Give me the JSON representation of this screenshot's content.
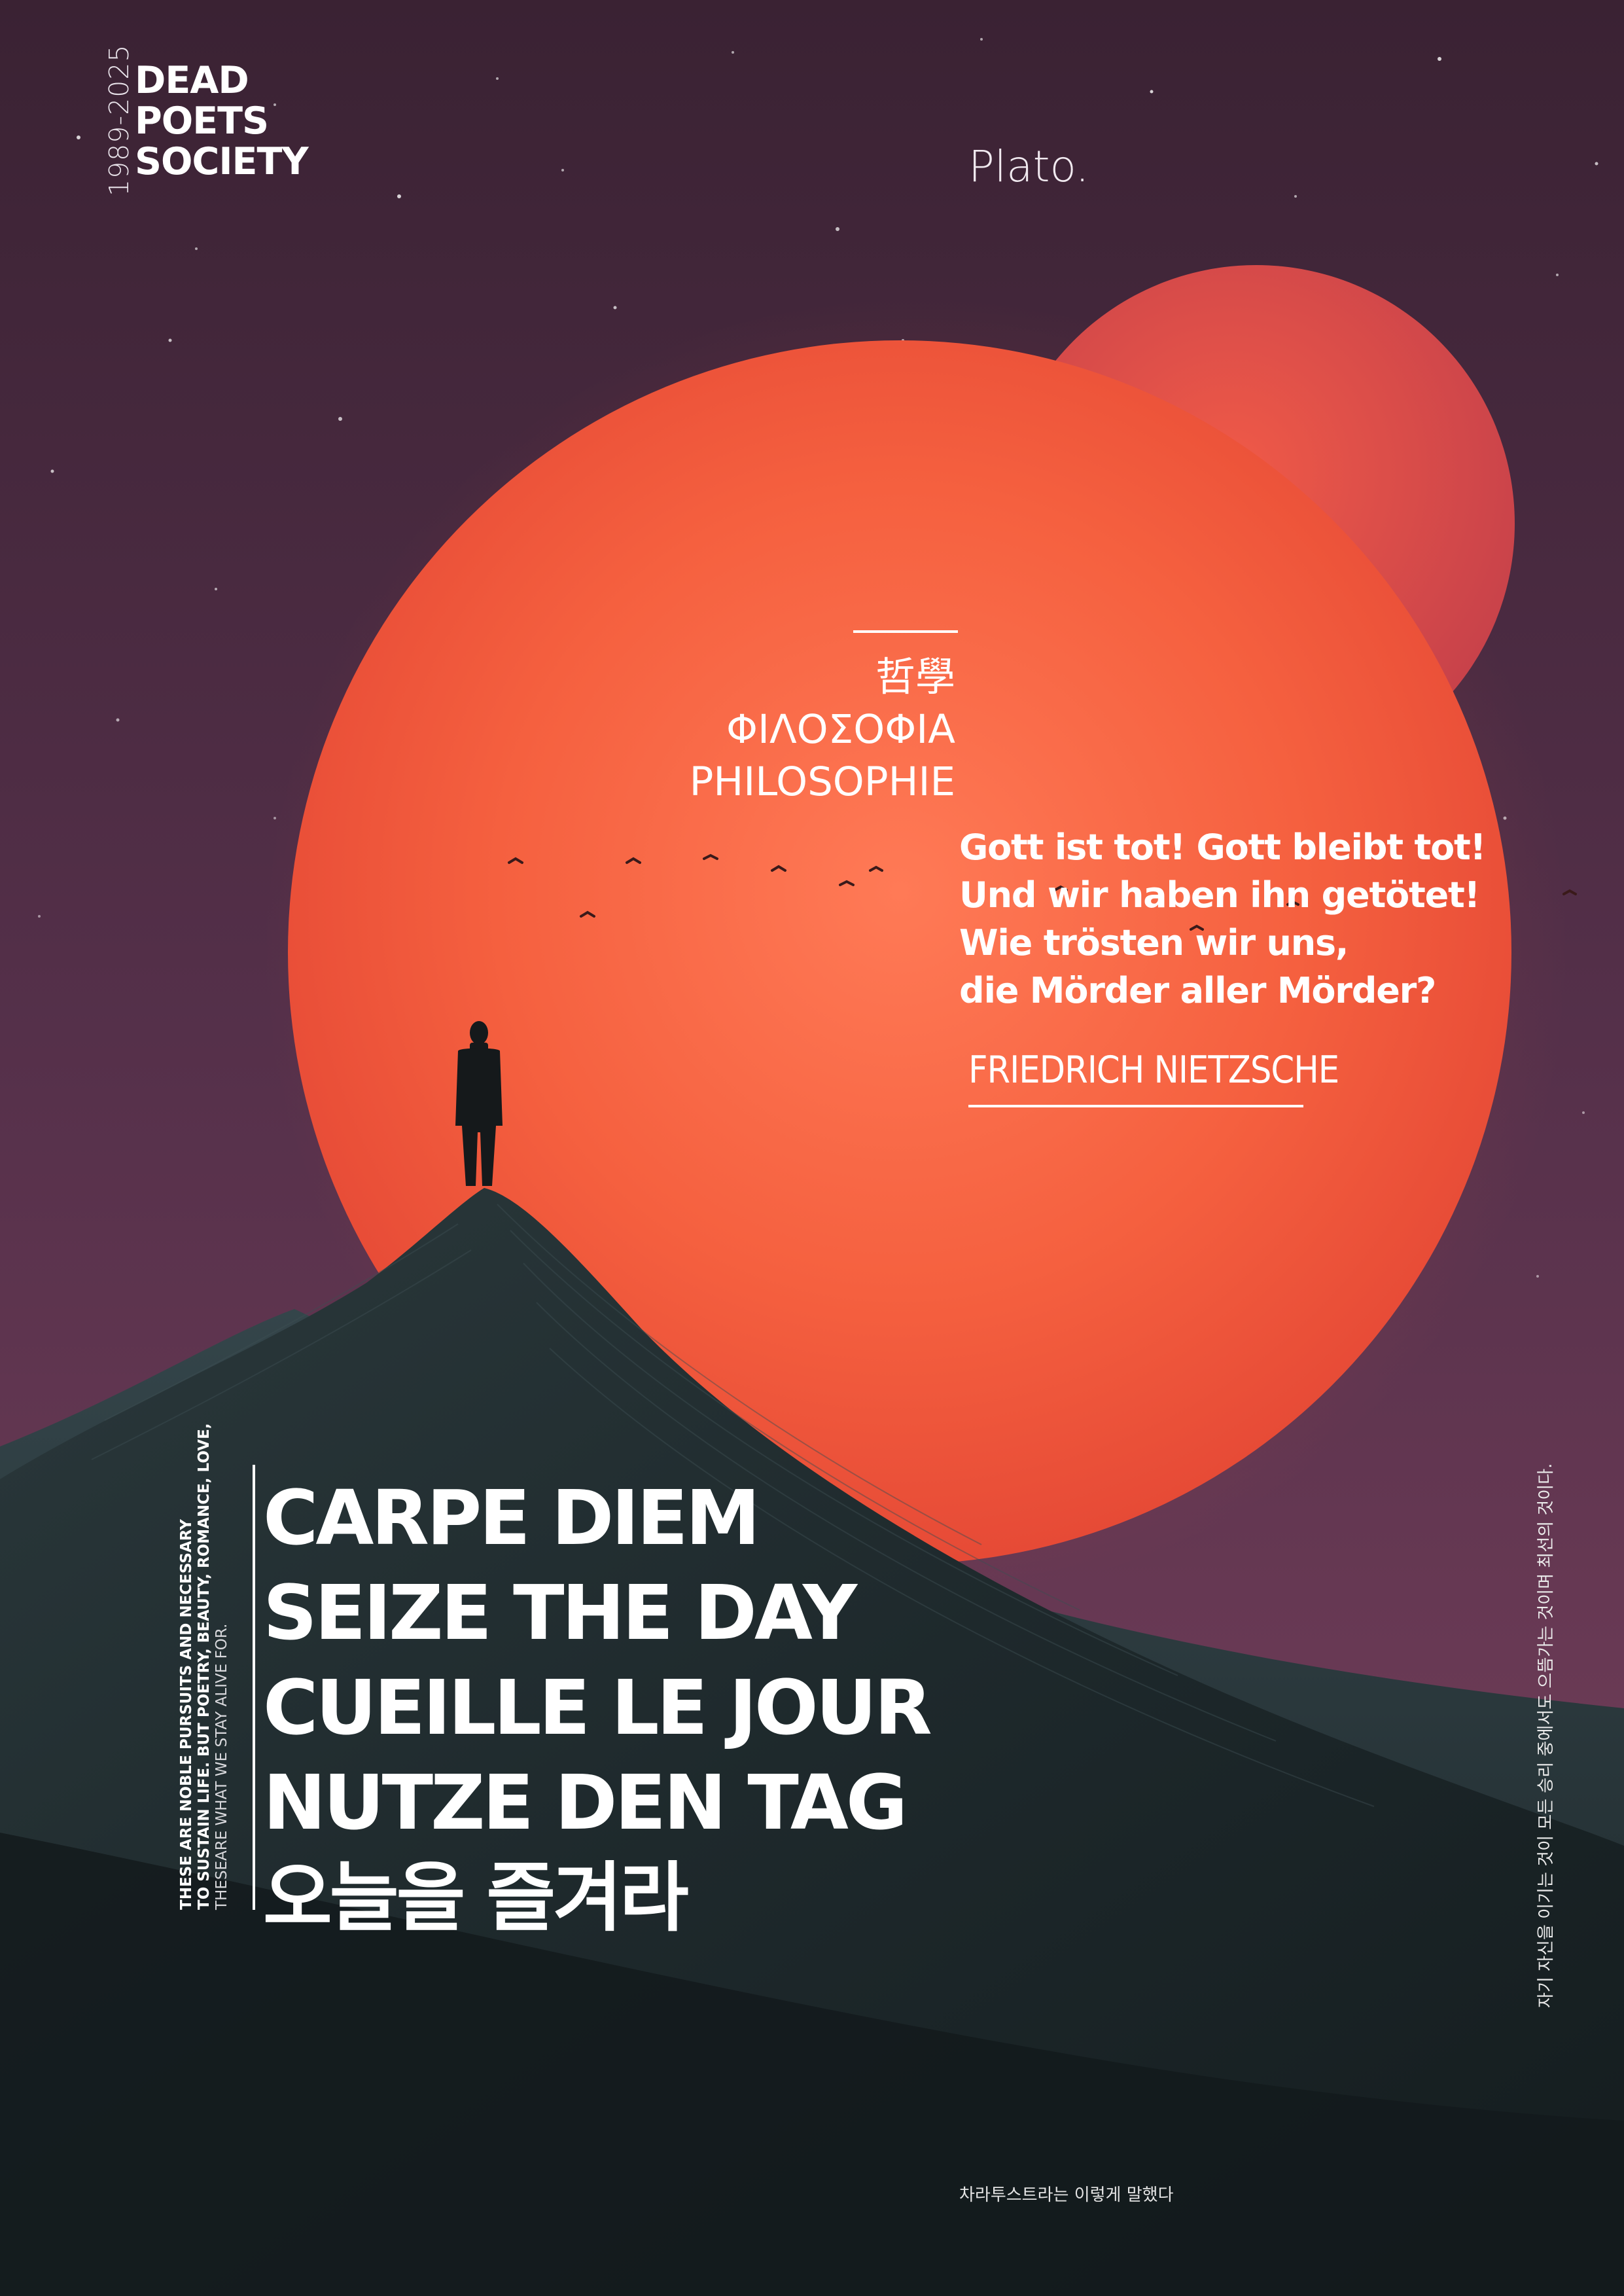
{
  "header": {
    "year_range": "1989-2025",
    "society_lines": [
      "DEAD",
      "POETS",
      "SOCIETY"
    ],
    "author_name": "Plato."
  },
  "philosophy": {
    "lines": [
      "哲學",
      "ΦΙΛΟΣΟΦΙΑ",
      "PHILOSOPHIE"
    ]
  },
  "quote": {
    "lines": [
      "Gott ist tot! Gott bleibt tot!",
      "Und wir haben ihn getötet!",
      "Wie trösten wir uns,",
      "die Mörder aller Mörder?"
    ],
    "author": "FRIEDRICH NIETZSCHE"
  },
  "carpe_diem": {
    "lines": [
      "CARPE DIEM",
      "SEIZE THE DAY",
      "CUEILLE LE JOUR",
      "NUTZE DEN TAG",
      "오늘을 즐겨라"
    ]
  },
  "side_note_left": {
    "lines": [
      "THESE ARE NOBLE PURSUITS AND NECESSARY",
      "TO SUSTAIN LIFE. BUT POETRY, BEAUTY, ROMANCE, LOVE,",
      "THESEARE WHAT WE STAY ALIVE FOR."
    ]
  },
  "side_note_right": "자기 자신을 이기는 것이 모든 승리 중에서도 으뜸가는 것이며 최선의 것이다.",
  "footer": "차라투스트라는 이렇게 말했다",
  "colors": {
    "sky_top": "#3e2536",
    "sky_mid": "#5a3048",
    "sun": "#f0573f",
    "sun_glow": "#ff7a56",
    "back_planet": "#e0524a",
    "dune_dark": "#1a2326",
    "dune_light": "#2c3a3d",
    "text": "#ffffff"
  }
}
